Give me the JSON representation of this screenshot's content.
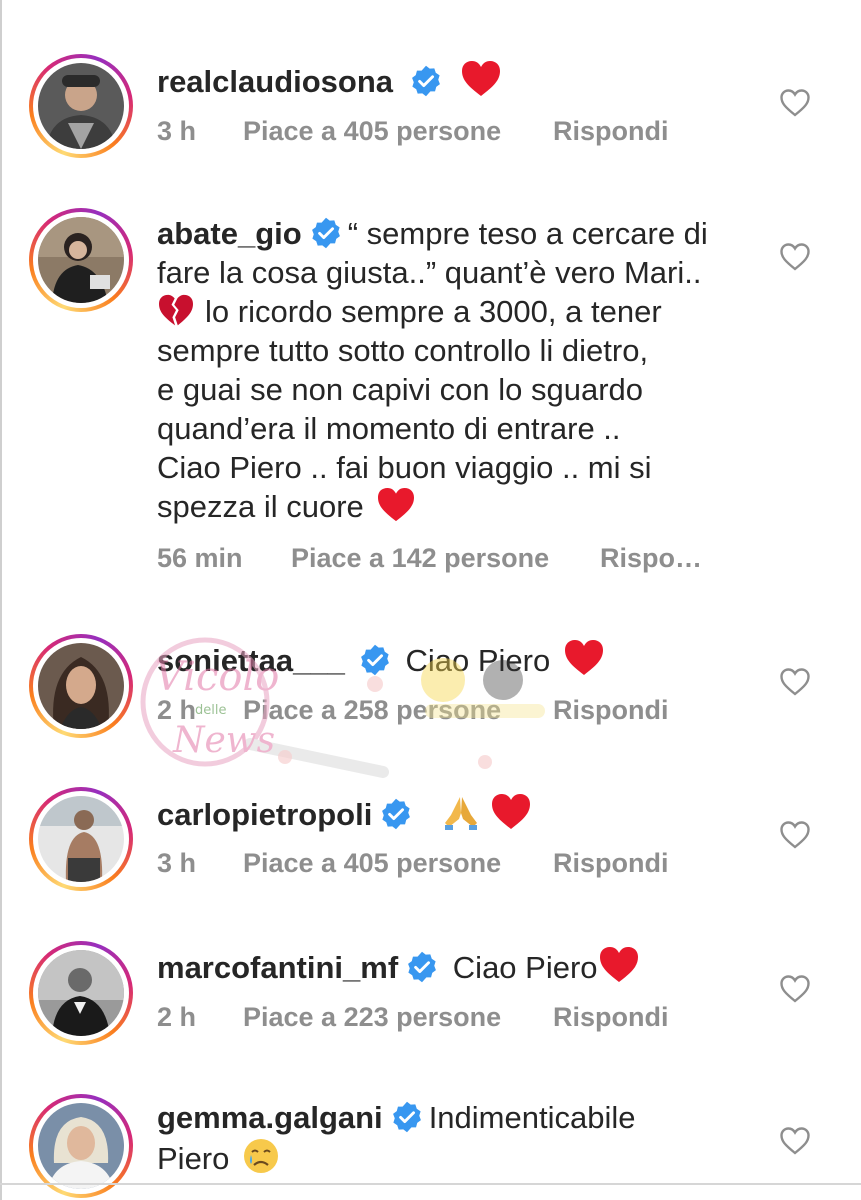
{
  "comments": [
    {
      "username": "realclaudiosona",
      "text": "",
      "emojis": [
        "heart"
      ],
      "time": "3 h",
      "likes": "Piace a 405 persone",
      "reply": "Rispondi"
    },
    {
      "username": "abate_gio",
      "text_lines": [
        "“ sempre teso a cercare di",
        "fare la cosa giusta..” quant’è vero Mari..",
        "lo ricordo sempre a 3000, a tener",
        "sempre tutto sotto controllo li dietro,",
        "e guai se non capivi con lo sguardo",
        "quand’era il momento di entrare ..",
        "Ciao Piero .. fai buon viaggio .. mi si",
        "spezza il cuore"
      ],
      "emojis": [
        "broken-heart",
        "heart"
      ],
      "time": "56 min",
      "likes": "Piace a 142 persone",
      "reply": "Rispo…"
    },
    {
      "username": "soniettaa___",
      "text": "Ciao Piero",
      "emojis": [
        "heart"
      ],
      "time": "2 h",
      "likes": "Piace a 258 persone",
      "reply": "Rispondi"
    },
    {
      "username": "carlopietropoli",
      "text": "",
      "emojis": [
        "folded-hands",
        "heart"
      ],
      "time": "3 h",
      "likes": "Piace a 405 persone",
      "reply": "Rispondi"
    },
    {
      "username": "marcofantini_mf",
      "text": "Ciao Piero",
      "emojis": [
        "heart"
      ],
      "time": "2 h",
      "likes": "Piace a 223 persone",
      "reply": "Rispondi"
    },
    {
      "username": "gemma.galgani",
      "text_lines": [
        "Indimenticabile",
        "Piero"
      ],
      "emojis": [
        "crying-face"
      ]
    }
  ],
  "watermark": {
    "line1": "Vicolo",
    "line2": "delle",
    "line3": "News"
  },
  "colors": {
    "text": "#262626",
    "meta": "#8e8e8e",
    "verified": "#3897f0",
    "heart": "#e8192c",
    "like_outline": "#8e8e8e"
  },
  "icons": [
    "verified-badge-icon",
    "heart-emoji-icon",
    "broken-heart-emoji-icon",
    "folded-hands-emoji-icon",
    "crying-face-emoji-icon",
    "like-heart-outline-icon"
  ]
}
